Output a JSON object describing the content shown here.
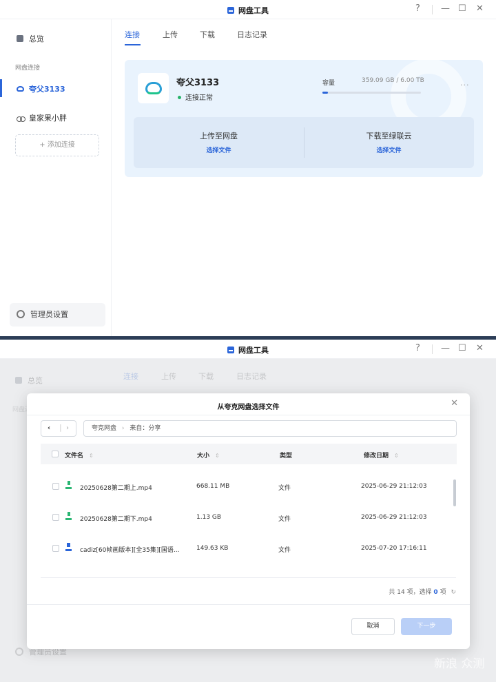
{
  "window_top": {
    "title": "网盘工具",
    "controls": {
      "help": "?",
      "minimize": "—",
      "maximize": "☐",
      "close": "✕"
    },
    "sidebar": {
      "overview": "总览",
      "group_label": "网盘连接",
      "account_active": "夸父3133",
      "account_other": "皇家果小胖",
      "add_connection": "+ 添加连接",
      "admin_settings": "管理员设置"
    },
    "tabs": [
      "连接",
      "上传",
      "下载",
      "日志记录"
    ],
    "card": {
      "account_name": "夸父3133",
      "status": "连接正常",
      "capacity_label": "容量",
      "capacity_value": "359.09 GB / 6.00 TB",
      "capacity_fraction": 0.058,
      "more": "···",
      "upload_title": "上传至网盘",
      "upload_link": "选择文件",
      "download_title": "下载至绿联云",
      "download_link": "选择文件"
    }
  },
  "window_bottom": {
    "title": "网盘工具",
    "bg_sidebar": {
      "overview": "总览",
      "group_label": "网盘连",
      "admin_settings": "管理员设置"
    },
    "bg_tabs": [
      "连接",
      "上传",
      "下载",
      "日志记录"
    ],
    "dialog": {
      "title": "从夸克网盘选择文件",
      "close": "✕",
      "back": "‹",
      "forward": "›",
      "path": [
        "夸克网盘",
        "来自：分享"
      ],
      "path_sep": "›",
      "columns": [
        "文件名",
        "大小",
        "类型",
        "修改日期"
      ],
      "sort_glyph": "⇕",
      "rows": [
        {
          "name": "20250628第二期上.mp4",
          "size": "668.11 MB",
          "type": "文件",
          "date": "2025-06-29 21:12:03",
          "icon": "video-file-icon"
        },
        {
          "name": "20250628第二期下.mp4",
          "size": "1.13 GB",
          "type": "文件",
          "date": "2025-06-29 21:12:03",
          "icon": "video-file-icon"
        },
        {
          "name": "cadiz[60帧画版本][全35集][国语...",
          "size": "149.63 KB",
          "type": "文件",
          "date": "2025-07-20 17:16:11",
          "icon": "document-file-icon"
        }
      ],
      "summary_prefix": "共 14 项，选择",
      "summary_count": "0",
      "summary_suffix": "项",
      "refresh": "↻",
      "cancel": "取消",
      "next": "下一步"
    },
    "watermark": "新浪 众测"
  },
  "colors": {
    "accent": "#2b65d9",
    "success": "#27b36a",
    "desktop": "#1c2431"
  }
}
